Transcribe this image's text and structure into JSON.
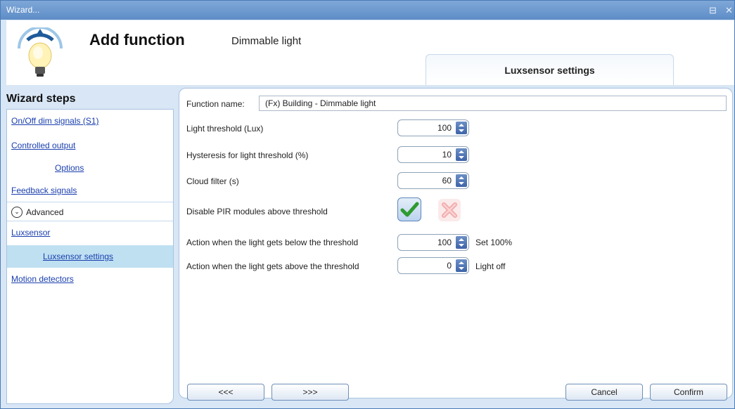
{
  "window": {
    "title": "Wizard...",
    "ctrl_restore": "⊟",
    "ctrl_close": "✕"
  },
  "header": {
    "title": "Add function",
    "subtitle": "Dimmable light",
    "tab": "Luxsensor settings"
  },
  "sidebar": {
    "title": "Wizard steps",
    "items": [
      {
        "label": "On/Off dim signals (S1)"
      },
      {
        "label": "Controlled output"
      },
      {
        "label": "Options"
      },
      {
        "label": "Feedback signals"
      },
      {
        "label": "Advanced"
      },
      {
        "label": "Luxsensor"
      },
      {
        "label": "Luxsensor settings"
      },
      {
        "label": "Motion detectors"
      }
    ]
  },
  "form": {
    "function_name_label": "Function name:",
    "function_name_value": "(Fx) Building - Dimmable light",
    "light_threshold_label": "Light threshold (Lux)",
    "light_threshold_value": "100",
    "hysteresis_label": "Hysteresis for light threshold (%)",
    "hysteresis_value": "10",
    "cloud_filter_label": "Cloud filter (s)",
    "cloud_filter_value": "60",
    "disable_pir_label": "Disable PIR modules above threshold",
    "below_label": "Action when the light gets below the threshold",
    "below_value": "100",
    "below_unit": "Set 100%",
    "above_label": "Action when the light gets above the threshold",
    "above_value": "0",
    "above_unit": "Light off"
  },
  "buttons": {
    "prev": "<<<",
    "next": ">>>",
    "cancel": "Cancel",
    "confirm": "Confirm"
  }
}
